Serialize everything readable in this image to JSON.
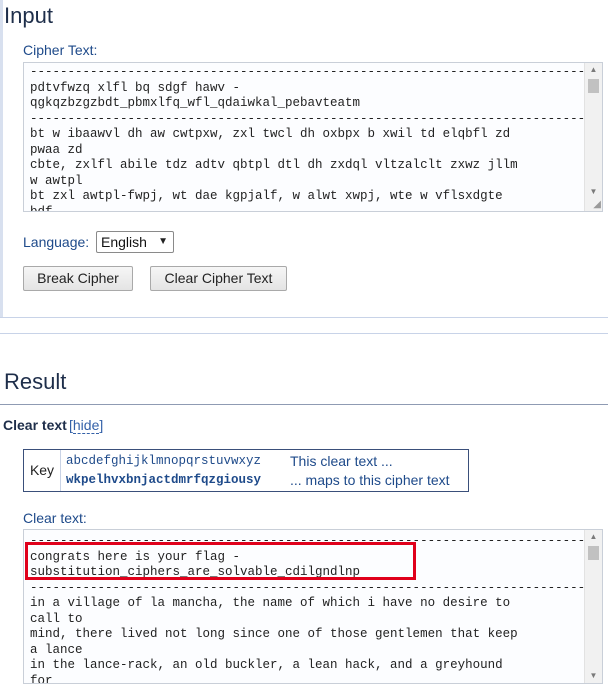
{
  "input_section": {
    "title": "Input",
    "cipher_label": "Cipher Text:",
    "cipher_text": "--------------------------------------------------------------------------------\npdtvfwzq xlfl bq sdgf hawv -\nqgkqzbzgzbdt_pbmxlfq_wfl_qdaiwkal_pebavteatm\n--------------------------------------------------------------------------------\nbt w ibaawvl dh aw cwtpxw, zxl twcl dh oxbpx b xwil td elqbfl zd\npwaa zd\ncbte, zxlfl abile tdz adtv qbtpl dtl dh zxdql vltzalclt zxwz jllm\nw awtpl\nbt zxl awtpl-fwpj, wt dae kgpjalf, w alwt xwpj, wte w vflsxdgte\nbdf",
    "language_label": "Language:",
    "language_value": "English",
    "break_button": "Break Cipher",
    "clear_button": "Clear Cipher Text"
  },
  "result_section": {
    "title": "Result",
    "clear_text_label": "Clear text",
    "hide_link": "hide",
    "key": {
      "label": "Key",
      "plain_alphabet": "abcdefghijklmnopqrstuvwxyz",
      "cipher_alphabet": "wkpelhvxbnjactdmrfqzgiousy",
      "plain_desc": "This clear text ...",
      "cipher_desc": "... maps to this cipher text"
    },
    "clear_text_field_label": "Clear text:",
    "clear_text": "--------------------------------------------------------------------------------\ncongrats here is your flag -\nsubstitution_ciphers_are_solvable_cdilgndlnp\n--------------------------------------------------------------------------------\nin a village of la mancha, the name of which i have no desire to\ncall to\nmind, there lived not long since one of those gentlemen that keep\na lance\nin the lance-rack, an old buckler, a lean hack, and a greyhound\nfor"
  },
  "colors": {
    "highlight": "#e0001b",
    "accent": "#1e4a8a"
  }
}
